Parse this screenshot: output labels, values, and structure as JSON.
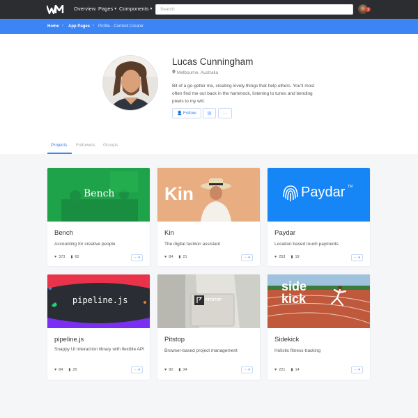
{
  "navbar": {
    "logo_text": "WM",
    "links": [
      "Overview",
      "Pages",
      "Components"
    ],
    "search_placeholder": "Search",
    "notification_count": "2"
  },
  "breadcrumb": {
    "items": [
      "Home",
      "App Pages",
      "Profile - Content Creator"
    ]
  },
  "profile": {
    "name": "Lucas Cunningham",
    "location": "Melbourne, Australia",
    "bio": "Bit of a go-getter me, creating lovely things that help others. You'll most often find me out back in the hammock, listening to tunes and bending pixels to my will.",
    "follow_label": "Follow",
    "more_label": "···"
  },
  "tabs": [
    "Projects",
    "Followers",
    "Groups"
  ],
  "projects": [
    {
      "title": "Bench",
      "description": "Accounting for creative people",
      "likes": "373",
      "comments": "62",
      "image_text": "Bench",
      "image_color": "#1fa34a"
    },
    {
      "title": "Kin",
      "description": "The digital fashion assistant",
      "likes": "84",
      "comments": "21",
      "image_text": "Kin",
      "image_color": "#e9ad82"
    },
    {
      "title": "Paydar",
      "description": "Location based touch payments",
      "likes": "253",
      "comments": "19",
      "image_text": "Paydar",
      "image_tm": "TM",
      "image_color": "#1685f5"
    },
    {
      "title": "pipeline.js",
      "description": "Snappy UI interaction library with flexible API",
      "likes": "84",
      "comments": "25",
      "image_text": "pipeline.js",
      "image_color": "#7b2ff2"
    },
    {
      "title": "Pitstop",
      "description": "Browser-based project management",
      "likes": "90",
      "comments": "34",
      "image_text": "PITSTOP",
      "image_color": "#cfcfc9"
    },
    {
      "title": "Sidekick",
      "description": "Holistic fitness tracking",
      "likes": "221",
      "comments": "14",
      "image_text": "side kick",
      "image_color": "#c0593c"
    }
  ],
  "card_menu_label": "··· ▾",
  "colors": {
    "accent": "#3d84f5",
    "navbar": "#2b2d31",
    "badge": "#e53935"
  }
}
